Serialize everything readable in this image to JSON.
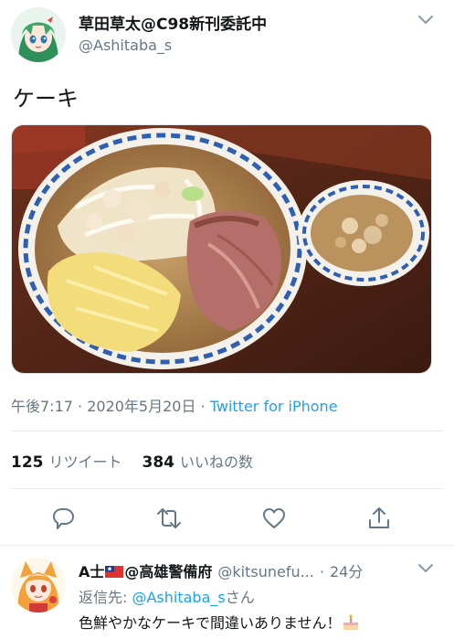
{
  "author": {
    "display_name": "草田草太@C98新刊委託中",
    "handle": "@Ashitaba_s"
  },
  "tweet": {
    "text": "ケーキ",
    "time": "午後7:17",
    "separator1": " · ",
    "date": "2020年5月20日",
    "separator2": " · ",
    "source": "Twitter for iPhone"
  },
  "stats": {
    "retweets_count": "125",
    "retweets_label": "リツイート",
    "likes_count": "384",
    "likes_label": "いいねの数"
  },
  "actions": [
    "reply-icon",
    "retweet-icon",
    "like-icon",
    "share-icon"
  ],
  "reply": {
    "name_prefix": "A士",
    "name_suffix": "@高雄警備府",
    "handle": "@kitsunefu...",
    "separator": "·",
    "time": "24分",
    "replying_label": "返信先: ",
    "replying_to": "@Ashitaba_s",
    "replying_suffix": "さん",
    "text": "色鮮やかなケーキで間違いありません！"
  },
  "colors": {
    "accent": "#1da1f2",
    "secondary_text": "#657786",
    "primary_text": "#14171a",
    "divider": "#e6ecf0"
  }
}
